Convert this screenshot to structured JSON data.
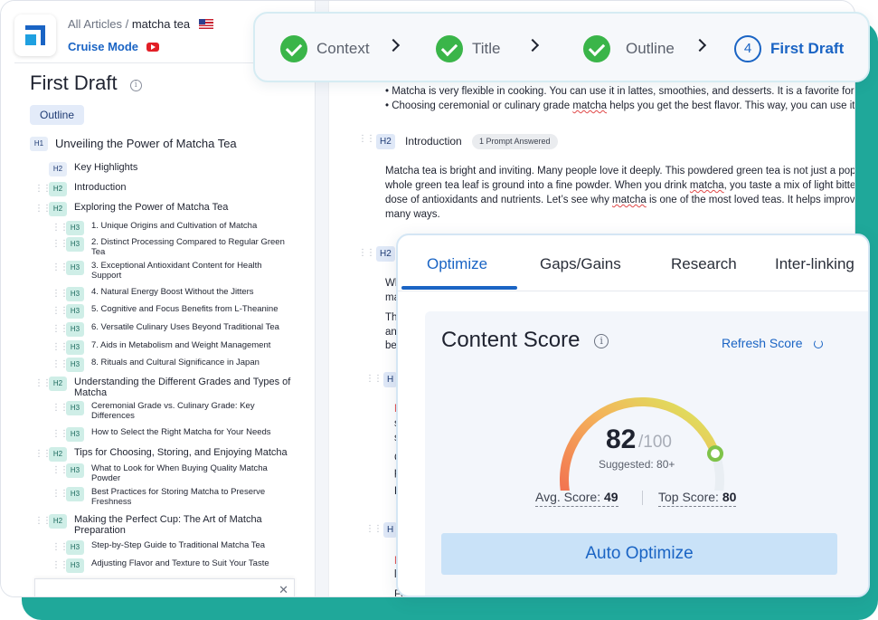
{
  "header": {
    "breadcrumb_parent": "All Articles",
    "breadcrumb_sep": "/",
    "breadcrumb_current": "matcha tea",
    "cruise_mode": "Cruise Mode"
  },
  "left_panel": {
    "title": "First Draft",
    "tab": "Outline",
    "outline": [
      {
        "level": "H1",
        "text": "Unveiling the Power of Matcha Tea"
      },
      {
        "level": "H2",
        "text": "Key Highlights"
      },
      {
        "level": "H2",
        "text": "Introduction"
      },
      {
        "level": "H2",
        "text": "Exploring the Power of Matcha Tea"
      },
      {
        "level": "H3",
        "text": "1. Unique Origins and Cultivation of Matcha"
      },
      {
        "level": "H3",
        "text": "2. Distinct Processing Compared to Regular Green Tea"
      },
      {
        "level": "H3",
        "text": "3. Exceptional Antioxidant Content for Health Support"
      },
      {
        "level": "H3",
        "text": "4. Natural Energy Boost Without the Jitters"
      },
      {
        "level": "H3",
        "text": "5. Cognitive and Focus Benefits from L-Theanine"
      },
      {
        "level": "H3",
        "text": "6. Versatile Culinary Uses Beyond Traditional Tea"
      },
      {
        "level": "H3",
        "text": "7. Aids in Metabolism and Weight Management"
      },
      {
        "level": "H3",
        "text": "8. Rituals and Cultural Significance in Japan"
      },
      {
        "level": "H2",
        "text": "Understanding the Different Grades and Types of Matcha"
      },
      {
        "level": "H3",
        "text": "Ceremonial Grade vs. Culinary Grade: Key Differences"
      },
      {
        "level": "H3",
        "text": "How to Select the Right Matcha for Your Needs"
      },
      {
        "level": "H2",
        "text": "Tips for Choosing, Storing, and Enjoying Matcha"
      },
      {
        "level": "H3",
        "text": "What to Look for When Buying Quality Matcha Powder"
      },
      {
        "level": "H3",
        "text": "Best Practices for Storing Matcha to Preserve Freshness"
      },
      {
        "level": "H2",
        "text": "Making the Perfect Cup: The Art of Matcha Preparation"
      },
      {
        "level": "H3",
        "text": "Step-by-Step Guide to Traditional Matcha Tea"
      },
      {
        "level": "H3",
        "text": "Adjusting Flavor and Texture to Suit Your Taste"
      }
    ]
  },
  "editor": {
    "bullet1": "• Matcha is very flexible in cooking. You can use it in lattes, smoothies, and desserts. It is a favorite for m",
    "bullet2_pre": "• Choosing ceremonial or culinary grade ",
    "bullet2_spell": "matcha",
    "bullet2_post": " helps you get the best flavor. This way, you can use it w",
    "section_badge": "H2",
    "section_title": "Introduction",
    "prompt_pill": "1 Prompt Answered",
    "para1_line1": "Matcha tea is bright and inviting. Many people love it deeply. This powdered green tea is not just a popu",
    "para1_line2_pre": "whole green tea leaf is ground into a fine powder. When you drink ",
    "para1_line2_spell1": "matcha",
    "para1_line2_mid": ", you taste a mix of light bitter",
    "para1_line3_pre": "dose of antioxidants and nutrients. Let’s see why ",
    "para1_line3_spell": "matcha",
    "para1_line3_post": " is one of the most loved teas. It helps improve",
    "para1_line4": "many ways.",
    "second_badge": "H2",
    "clip_texts": [
      "Wh",
      "ma",
      "Th",
      "and",
      "be",
      "H",
      "N",
      "s",
      "s",
      "C",
      "p",
      "E",
      "H",
      "M",
      "l",
      "Fo"
    ]
  },
  "stepper": {
    "steps": [
      {
        "label": "Context",
        "state": "done"
      },
      {
        "label": "Title",
        "state": "done"
      },
      {
        "label": "Outline",
        "state": "done"
      },
      {
        "label": "First Draft",
        "state": "active",
        "number": "4"
      }
    ]
  },
  "optimize_panel": {
    "tabs": [
      "Optimize",
      "Gaps/Gains",
      "Research",
      "Inter-linking"
    ],
    "content_score_title": "Content Score",
    "refresh_label": "Refresh Score",
    "score": "82",
    "score_max": "/100",
    "score_fraction": 0.82,
    "suggested": "Suggested: 80+",
    "avg_label": "Avg. Score:",
    "avg_value": "49",
    "top_label": "Top Score:",
    "top_value": "80",
    "auto_optimize": "Auto Optimize"
  },
  "colors": {
    "brand_blue": "#1a64c4",
    "teal_bg": "#1fa89a",
    "check_green": "#3ab549",
    "gauge_start": "#f26a4f",
    "gauge_end": "#d8ec5e"
  }
}
